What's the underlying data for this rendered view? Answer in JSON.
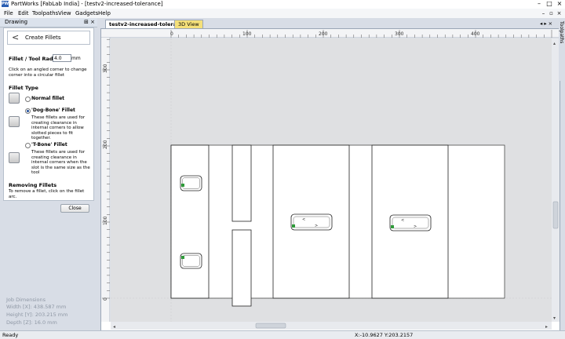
{
  "window": {
    "logo": "PW",
    "title": "PartWorks [FabLab India] - [testv2-increased-tolerance]",
    "controls": [
      "–",
      "□",
      "×"
    ]
  },
  "menu": {
    "items": [
      "File",
      "Edit",
      "Toolpaths",
      "View",
      "Gadgets",
      "Help"
    ],
    "mdi_controls": [
      "–",
      "▫",
      "×"
    ]
  },
  "panel": {
    "title": "Drawing",
    "pin": "⊞ ×",
    "header": {
      "back": "<",
      "title": "Create Fillets"
    },
    "radius": {
      "label": "Fillet / Tool Radius:",
      "value": "4.0",
      "unit": "mm"
    },
    "instruction": "Click on an angled corner to change corner into a circular fillet",
    "fillet_type_label": "Fillet Type",
    "options": [
      {
        "label": "Normal fillet",
        "desc": "",
        "selected": false
      },
      {
        "label": "'Dog-Bone' Fillet",
        "desc": "These fillets are used for creating clearance in internal corners to allow slotted pieces to fit together.",
        "selected": true
      },
      {
        "label": "'T-Bone' Fillet",
        "desc": "These fillets are used for creating clearance in internal corners when the slot is the same size as the tool",
        "selected": false
      }
    ],
    "removing_label": "Removing Fillets",
    "removing_text": "To remove a fillet, click on the fillet arc.",
    "close_label": "Close"
  },
  "job_dimensions": {
    "title": "Job Dimensions",
    "width": "Width  [X]: 438.587 mm",
    "height": "Height [Y]: 203.215 mm",
    "depth": "Depth  [Z]: 16.0 mm"
  },
  "tabs": [
    {
      "label": "testv2-increased-tolerance",
      "active": true
    },
    {
      "label": "3D View",
      "active": false
    }
  ],
  "tab_nav": "◂ ▸ ×",
  "ruler": {
    "top_labels": [
      "0",
      "100",
      "200",
      "300",
      "400"
    ],
    "left_labels": [
      "300",
      "200",
      "100",
      "0"
    ]
  },
  "right_tab": "Toolpaths",
  "status": {
    "left": "Ready",
    "coords": "X:-10.9627 Y:203.2157"
  }
}
